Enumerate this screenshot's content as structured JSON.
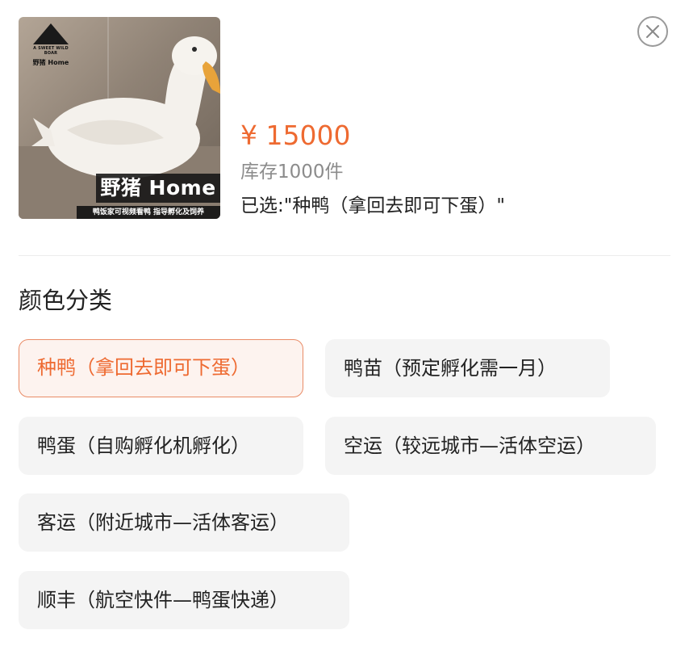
{
  "product": {
    "image_logo_text": "野猪 Home",
    "image_banner": "野猪 Home",
    "image_caption": "鸭饭家可视频看鸭 指导孵化及饲养",
    "price": "¥ 15000",
    "stock": "库存1000件",
    "selected": "已选:\"种鸭（拿回去即可下蛋）\""
  },
  "close": {
    "icon": "close-icon"
  },
  "options_section": {
    "title": "颜色分类",
    "items": [
      {
        "label": "种鸭（拿回去即可下蛋）",
        "selected": true
      },
      {
        "label": "鸭苗（预定孵化需一月）",
        "selected": false
      },
      {
        "label": "鸭蛋（自购孵化机孵化）",
        "selected": false
      },
      {
        "label": "空运（较远城市—活体空运）",
        "selected": false
      },
      {
        "label": "客运（附近城市—活体客运）",
        "selected": false
      },
      {
        "label": "顺丰（航空快件—鸭蛋快递）",
        "selected": false
      }
    ]
  },
  "colors": {
    "accent": "#ee6a31",
    "accent_border": "#e98b66",
    "chip_bg": "#f4f4f4"
  }
}
